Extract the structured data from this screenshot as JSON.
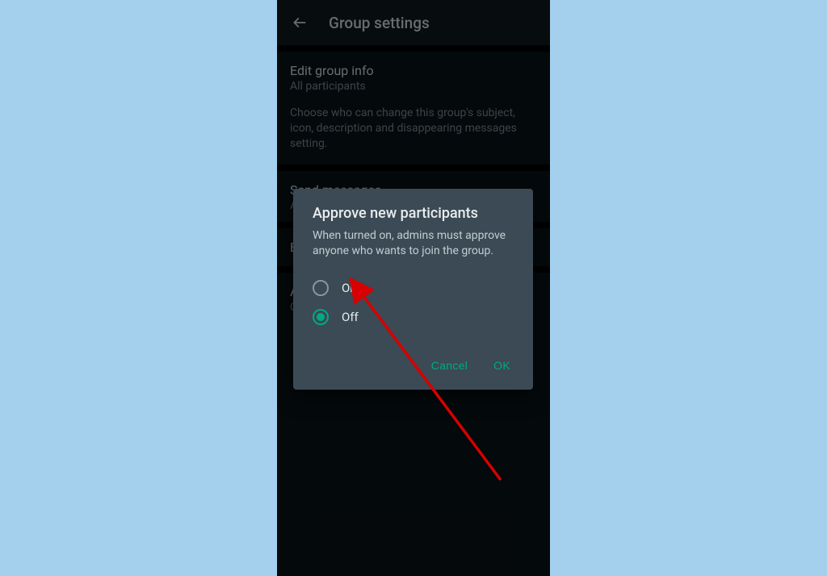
{
  "header": {
    "title": "Group settings"
  },
  "sections": {
    "edit_info": {
      "title": "Edit group info",
      "subtitle": "All participants",
      "description": "Choose who can change this group's subject, icon, description and disappearing messages setting."
    },
    "send_messages": {
      "title": "Send messages",
      "subtitle": "All participants"
    },
    "edit_admins_partial": {
      "title": "E"
    },
    "approve_partial": {
      "title": "A",
      "subtitle": "O"
    }
  },
  "dialog": {
    "title": "Approve new participants",
    "description": "When turned on, admins must approve anyone who wants to join the group.",
    "options": {
      "on": "On",
      "off": "Off"
    },
    "selected": "off",
    "buttons": {
      "cancel": "Cancel",
      "ok": "OK"
    }
  },
  "colors": {
    "accent": "#00a884",
    "annotation": "#d80000"
  }
}
